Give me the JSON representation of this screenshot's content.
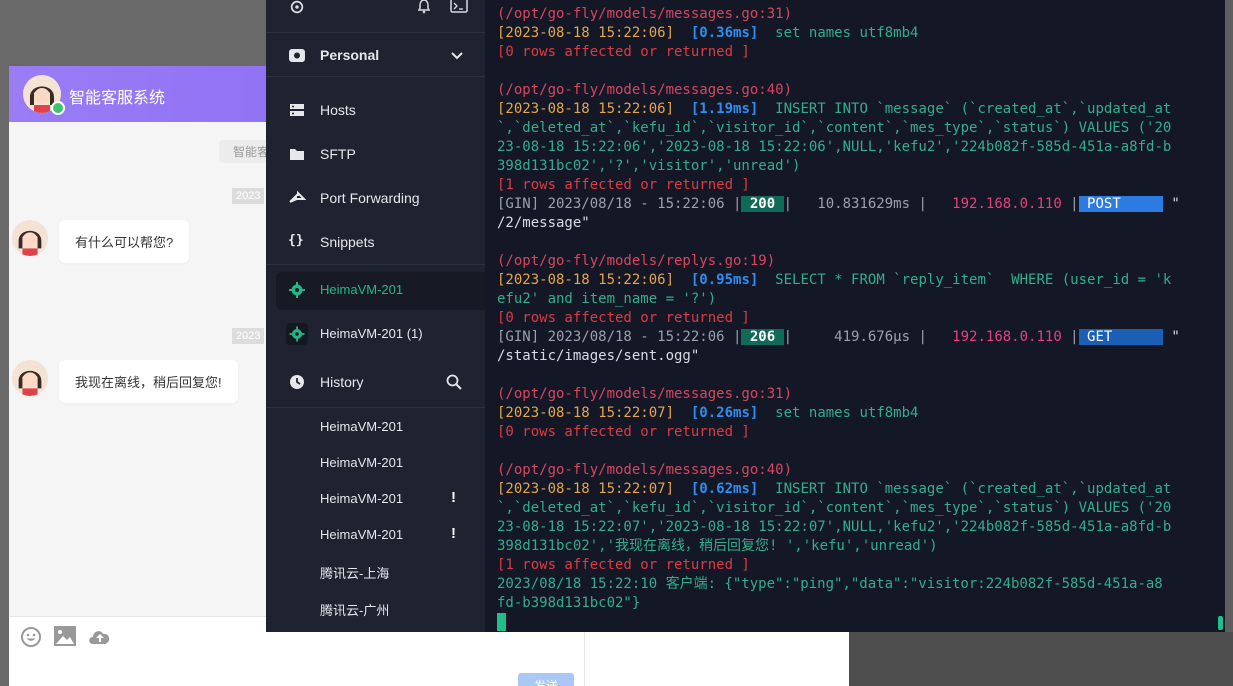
{
  "chat": {
    "title": "智能客服系统",
    "system_notice": "智能客",
    "date_chip_1": "2023",
    "date_chip_2": "2023",
    "messages": [
      {
        "text": "有什么可以帮您?"
      },
      {
        "text": "我现在离线，稍后回复您!"
      }
    ],
    "send_label": "发送"
  },
  "sidebar": {
    "vault_label": "Personal",
    "nav": [
      {
        "label": "Hosts",
        "icon": "hosts-icon"
      },
      {
        "label": "SFTP",
        "icon": "folder-icon"
      },
      {
        "label": "Port Forwarding",
        "icon": "port-forward-icon"
      },
      {
        "label": "Snippets",
        "icon": "braces-icon"
      }
    ],
    "open_hosts": [
      {
        "label": "HeimaVM-201"
      },
      {
        "label": "HeimaVM-201 (1)"
      }
    ],
    "history_label": "History",
    "history_items": [
      {
        "label": "HeimaVM-201",
        "warning": ""
      },
      {
        "label": "HeimaVM-201",
        "warning": ""
      },
      {
        "label": "HeimaVM-201",
        "warning": "!"
      },
      {
        "label": "HeimaVM-201",
        "warning": "!"
      },
      {
        "label": "腾讯云-上海",
        "warning": ""
      },
      {
        "label": "腾讯云-广州",
        "warning": ""
      }
    ]
  },
  "terminal": {
    "lines": [
      {
        "spans": [
          {
            "cls": "c-path",
            "t": "(/opt/go-fly/models/messages.go:31)"
          }
        ]
      },
      {
        "spans": [
          {
            "cls": "c-date",
            "t": "[2023-08-18 15:22:06]  "
          },
          {
            "cls": "c-ms",
            "t": "[0.36ms]"
          },
          {
            "cls": "c-sql",
            "t": "  set names utf8mb4"
          }
        ]
      },
      {
        "spans": [
          {
            "cls": "c-red",
            "t": "[0 rows affected or returned ]"
          }
        ]
      },
      {
        "spans": []
      },
      {
        "spans": [
          {
            "cls": "c-path",
            "t": "(/opt/go-fly/models/messages.go:40)"
          }
        ]
      },
      {
        "spans": [
          {
            "cls": "c-date",
            "t": "[2023-08-18 15:22:06]  "
          },
          {
            "cls": "c-ms",
            "t": "[1.19ms]"
          },
          {
            "cls": "c-sql",
            "t": "  INSERT INTO `message` (`created_at`,`updated_at"
          }
        ]
      },
      {
        "spans": [
          {
            "cls": "c-sql",
            "t": "`,`deleted_at`,`kefu_id`,`visitor_id`,`content`,`mes_type`,`status`) VALUES ('20"
          }
        ]
      },
      {
        "spans": [
          {
            "cls": "c-sql",
            "t": "23-08-18 15:22:06','2023-08-18 15:22:06',NULL,'kefu2','224b082f-585d-451a-a8fd-b"
          }
        ]
      },
      {
        "spans": [
          {
            "cls": "c-sql",
            "t": "398d131bc02','?','visitor','unread')"
          }
        ]
      },
      {
        "spans": [
          {
            "cls": "c-red",
            "t": "[1 rows affected or returned ]"
          }
        ]
      },
      {
        "spans": [
          {
            "cls": "c-gin",
            "t": "[GIN] 2023/08/18 - 15:22:06 |"
          },
          {
            "cls": "badge200",
            "t": " 200 "
          },
          {
            "cls": "c-gin",
            "t": "|   10.831629ms |   "
          },
          {
            "cls": "c-ip",
            "t": "192.168.0.110"
          },
          {
            "cls": "c-gin",
            "t": " |"
          },
          {
            "cls": "badgePost",
            "t": " POST     "
          },
          {
            "cls": "c-white",
            "t": " \""
          }
        ]
      },
      {
        "spans": [
          {
            "cls": "c-white",
            "t": "/2/message\""
          }
        ]
      },
      {
        "spans": []
      },
      {
        "spans": [
          {
            "cls": "c-path",
            "t": "(/opt/go-fly/models/replys.go:19)"
          }
        ]
      },
      {
        "spans": [
          {
            "cls": "c-date",
            "t": "[2023-08-18 15:22:06]  "
          },
          {
            "cls": "c-ms",
            "t": "[0.95ms]"
          },
          {
            "cls": "c-sql",
            "t": "  SELECT * FROM `reply_item`  WHERE (user_id = 'k"
          }
        ]
      },
      {
        "spans": [
          {
            "cls": "c-sql",
            "t": "efu2' and item_name = '?')"
          }
        ]
      },
      {
        "spans": [
          {
            "cls": "c-red",
            "t": "[0 rows affected or returned ]"
          }
        ]
      },
      {
        "spans": [
          {
            "cls": "c-gin",
            "t": "[GIN] 2023/08/18 - 15:22:06 |"
          },
          {
            "cls": "badge206",
            "t": " 206 "
          },
          {
            "cls": "c-gin",
            "t": "|     419.676µs |   "
          },
          {
            "cls": "c-ip",
            "t": "192.168.0.110"
          },
          {
            "cls": "c-gin",
            "t": " |"
          },
          {
            "cls": "badgeGet",
            "t": " GET      "
          },
          {
            "cls": "c-white",
            "t": " \""
          }
        ]
      },
      {
        "spans": [
          {
            "cls": "c-white",
            "t": "/static/images/sent.ogg\""
          }
        ]
      },
      {
        "spans": []
      },
      {
        "spans": [
          {
            "cls": "c-path",
            "t": "(/opt/go-fly/models/messages.go:31)"
          }
        ]
      },
      {
        "spans": [
          {
            "cls": "c-date",
            "t": "[2023-08-18 15:22:07]  "
          },
          {
            "cls": "c-ms",
            "t": "[0.26ms]"
          },
          {
            "cls": "c-sql",
            "t": "  set names utf8mb4"
          }
        ]
      },
      {
        "spans": [
          {
            "cls": "c-red",
            "t": "[0 rows affected or returned ]"
          }
        ]
      },
      {
        "spans": []
      },
      {
        "spans": [
          {
            "cls": "c-path",
            "t": "(/opt/go-fly/models/messages.go:40)"
          }
        ]
      },
      {
        "spans": [
          {
            "cls": "c-date",
            "t": "[2023-08-18 15:22:07]  "
          },
          {
            "cls": "c-ms",
            "t": "[0.62ms]"
          },
          {
            "cls": "c-sql",
            "t": "  INSERT INTO `message` (`created_at`,`updated_at"
          }
        ]
      },
      {
        "spans": [
          {
            "cls": "c-sql",
            "t": "`,`deleted_at`,`kefu_id`,`visitor_id`,`content`,`mes_type`,`status`) VALUES ('20"
          }
        ]
      },
      {
        "spans": [
          {
            "cls": "c-sql",
            "t": "23-08-18 15:22:07','2023-08-18 15:22:07',NULL,'kefu2','224b082f-585d-451a-a8fd-b"
          }
        ]
      },
      {
        "spans": [
          {
            "cls": "c-sql",
            "t": "398d131bc02','我现在离线，稍后回复您! ','kefu','unread')"
          }
        ]
      },
      {
        "spans": [
          {
            "cls": "c-red",
            "t": "[1 rows affected or returned ]"
          }
        ]
      },
      {
        "spans": [
          {
            "cls": "c-sql",
            "t": "2023/08/18 15:22:10 客户端: {\"type\":\"ping\",\"data\":\"visitor:224b082f-585d-451a-a8"
          }
        ]
      },
      {
        "spans": [
          {
            "cls": "c-sql",
            "t": "fd-b398d131bc02\"}"
          }
        ]
      }
    ]
  }
}
